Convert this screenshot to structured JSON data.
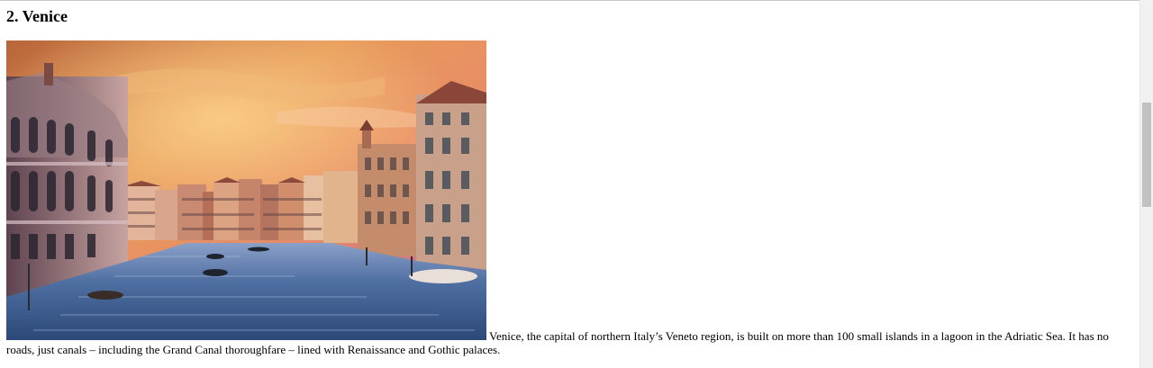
{
  "section": {
    "heading": "2. Venice",
    "image_alt": "Grand Canal in Venice at sunset",
    "description": "Venice, the capital of northern Italy’s Veneto region, is built on more than 100 small islands in a lagoon in the Adriatic Sea. It has no roads, just canals – including the Grand Canal thoroughfare – lined with Renaissance and Gothic palaces."
  },
  "colors": {
    "sky_top": "#c97a3f",
    "sky_mid": "#e8a05c",
    "sky_pink": "#d86a7a",
    "sky_blue": "#6f7fc0",
    "water": "#3f5f8f",
    "scrollbar_track": "#f1f1f1",
    "scrollbar_thumb": "#c1c1c1"
  }
}
